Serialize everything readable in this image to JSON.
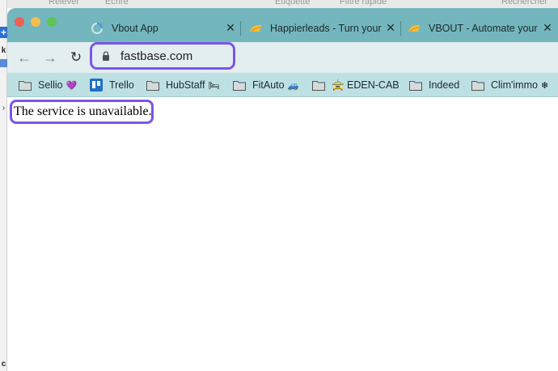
{
  "background_app": {
    "items": [
      "Relever",
      "Écrire",
      "Étiquette",
      "Filtre rapide",
      "Rechercher"
    ],
    "left_strip": {
      "plus": "+",
      "k": "k",
      "c": "c"
    }
  },
  "window": {
    "tabs": [
      {
        "title": "Vbout App",
        "favicon": "loading-spinner-icon"
      },
      {
        "title": "Happierleads - Turn your",
        "favicon": "happierleads-logo-icon"
      },
      {
        "title": "VBOUT - Automate your",
        "favicon": "vbout-logo-icon"
      }
    ],
    "close_glyph": "✕"
  },
  "toolbar": {
    "back_glyph": "←",
    "forward_glyph": "→",
    "reload_glyph": "↻",
    "url": "fastbase.com"
  },
  "bookmarks": [
    {
      "label": "Sellio",
      "emoji": "💜",
      "icon": "folder-icon"
    },
    {
      "label": "Trello",
      "emoji": "",
      "icon": "trello-icon"
    },
    {
      "label": "HubStaff",
      "emoji": "🛏",
      "icon": "folder-icon"
    },
    {
      "label": "FitAuto",
      "emoji": "🚙",
      "icon": "folder-icon"
    },
    {
      "label": "🚖 EDEN-CAB",
      "emoji": "",
      "icon": "folder-icon"
    },
    {
      "label": "Indeed",
      "emoji": "",
      "icon": "folder-icon"
    },
    {
      "label": "Clim'immo",
      "emoji": "❄",
      "icon": "folder-icon"
    }
  ],
  "page": {
    "message": "The service is unavailable."
  },
  "colors": {
    "tabbar": "#73b6bd",
    "toolbar": "#e3eef0",
    "bookmarks_bar": "#bde0e3",
    "highlight": "#7b56e8"
  }
}
